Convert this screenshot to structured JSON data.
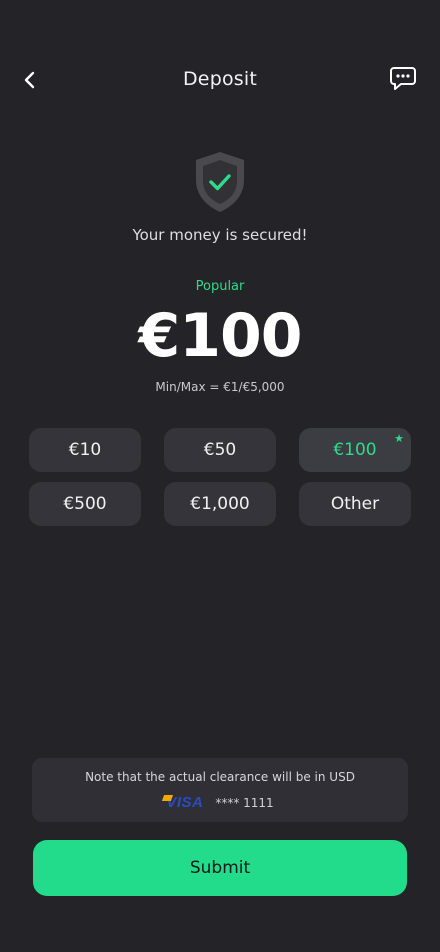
{
  "header": {
    "title": "Deposit",
    "back_icon": "chevron-left-icon",
    "chat_icon": "chat-bubble-icon"
  },
  "security": {
    "icon": "shield-check-icon",
    "text": "Your money is secured!"
  },
  "amount": {
    "tag": "Popular",
    "value": "€100",
    "limits": "Min/Max = €1/€5,000"
  },
  "chips": [
    {
      "label": "€10",
      "selected": false
    },
    {
      "label": "€50",
      "selected": false
    },
    {
      "label": "€100",
      "selected": true,
      "badge": "★"
    },
    {
      "label": "€500",
      "selected": false
    },
    {
      "label": "€1,000",
      "selected": false
    },
    {
      "label": "Other",
      "selected": false
    }
  ],
  "note": {
    "text": "Note that the actual clearance will be in USD",
    "card_brand": "VISA",
    "card_number": "**** 1111"
  },
  "submit_label": "Submit",
  "colors": {
    "background": "#242428",
    "accent": "#22dc8c",
    "chip": "#34343a"
  }
}
